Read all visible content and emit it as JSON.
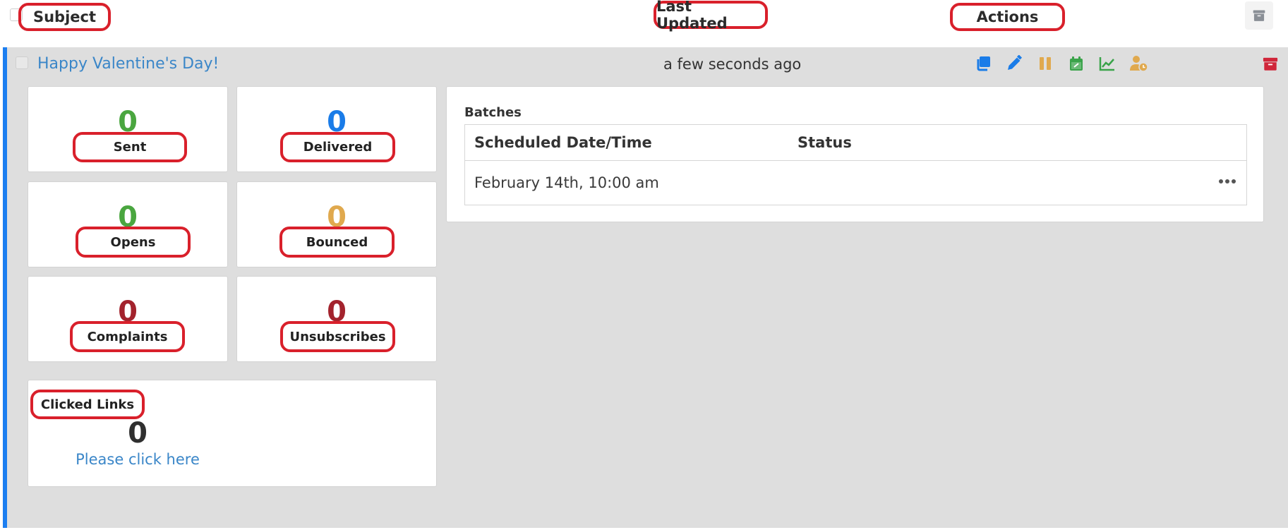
{
  "header": {
    "subject_label": "Subject",
    "last_updated_label": "Last Updated",
    "actions_label": "Actions"
  },
  "campaign": {
    "subject": "Happy Valentine's Day!",
    "last_updated": "a few seconds ago",
    "action_icons": [
      "copy-icon",
      "edit-icon",
      "pause-icon",
      "schedule-icon",
      "chart-icon",
      "user-clock-icon"
    ],
    "stats": {
      "sent": {
        "value": "0",
        "label": "Sent",
        "color": "#4aa63f"
      },
      "delivered": {
        "value": "0",
        "label": "Delivered",
        "color": "#1a7ce8"
      },
      "opens": {
        "value": "0",
        "label": "Opens",
        "color": "#4aa63f"
      },
      "bounced": {
        "value": "0",
        "label": "Bounced",
        "color": "#e0a94e"
      },
      "complaints": {
        "value": "0",
        "label": "Complaints",
        "color": "#a3232d"
      },
      "unsubscribes": {
        "value": "0",
        "label": "Unsubscribes",
        "color": "#a3232d"
      }
    },
    "clicked_links": {
      "label": "Clicked Links",
      "value": "0",
      "link_text": "Please click here"
    },
    "batches": {
      "title": "Batches",
      "columns": [
        "Scheduled Date/Time",
        "Status"
      ],
      "rows": [
        {
          "scheduled": "February 14th, 10:00 am",
          "status": ""
        }
      ]
    }
  },
  "colors": {
    "accent_blue": "#1c7ef0",
    "link_blue": "#3a86c8",
    "annotation_red": "#d9202b",
    "archive_red": "#d0263a"
  }
}
